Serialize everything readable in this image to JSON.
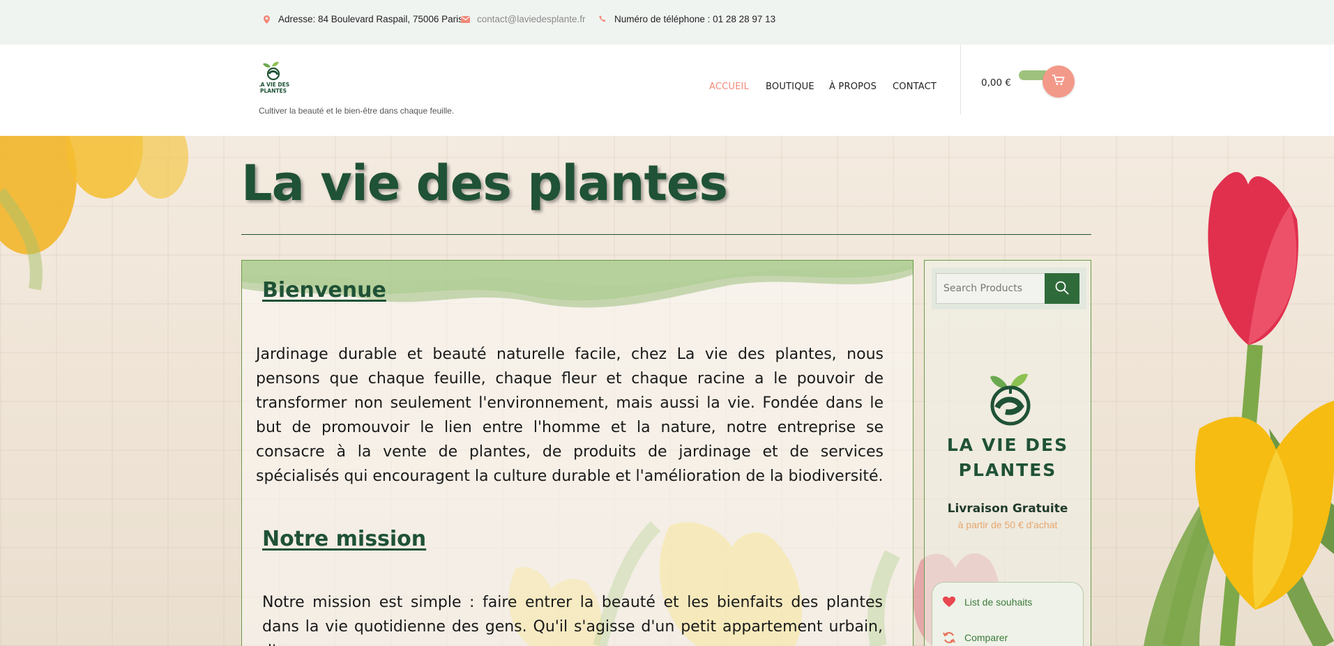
{
  "topbar": {
    "address": "Adresse: 84 Boulevard Raspail, 75006 Paris",
    "email": "contact@laviedesplante.fr",
    "phone": "Numéro de téléphone : 01 28 28 97 13",
    "icons": [
      "map-pin-icon",
      "envelope-icon",
      "phone-icon"
    ]
  },
  "header": {
    "logo_text": "LA VIE DES PLANTES",
    "tagline": "Cultiver la beauté et le bien-être dans chaque feuille.",
    "nav": [
      {
        "label": "ACCUEIL",
        "active": true
      },
      {
        "label": "BOUTIQUE",
        "active": false
      },
      {
        "label": "À PROPOS",
        "active": false
      },
      {
        "label": "CONTACT",
        "active": false
      }
    ],
    "cart_total": "0,00 €"
  },
  "hero": {
    "title": "La vie des plantes"
  },
  "content": {
    "welcome_heading": "Bienvenue",
    "welcome_text": "Jardinage durable et beauté naturelle facile, chez La vie des plantes, nous pensons que chaque feuille, chaque fleur et chaque racine a le pouvoir de transformer non seulement l'environnement, mais aussi la vie. Fondée dans le but de promouvoir le lien entre l'homme et la nature, notre entreprise se consacre à la vente de plantes, de produits de jardinage et de services spécialisés qui encouragent la culture durable et l'amélioration de la biodiversité.",
    "mission_heading": "Notre mission",
    "mission_text": "Notre mission est simple : faire entrer la beauté et les bienfaits des plantes dans la vie quotidienne des gens. Qu'il s'agisse d'un petit appartement urbain, d'une"
  },
  "sidebar": {
    "search_placeholder": "Search Products",
    "brand_line1": "LA VIE DES",
    "brand_line2": "PLANTES",
    "free_shipping": "Livraison Gratuite",
    "free_shipping_sub": "à partir de 50 € d'achat",
    "wishlist": "List de souhaits",
    "compare": "Comparer"
  },
  "colors": {
    "brand_green": "#1f5236",
    "accent_salmon": "#f2897a",
    "light_green": "#9ec27e"
  }
}
